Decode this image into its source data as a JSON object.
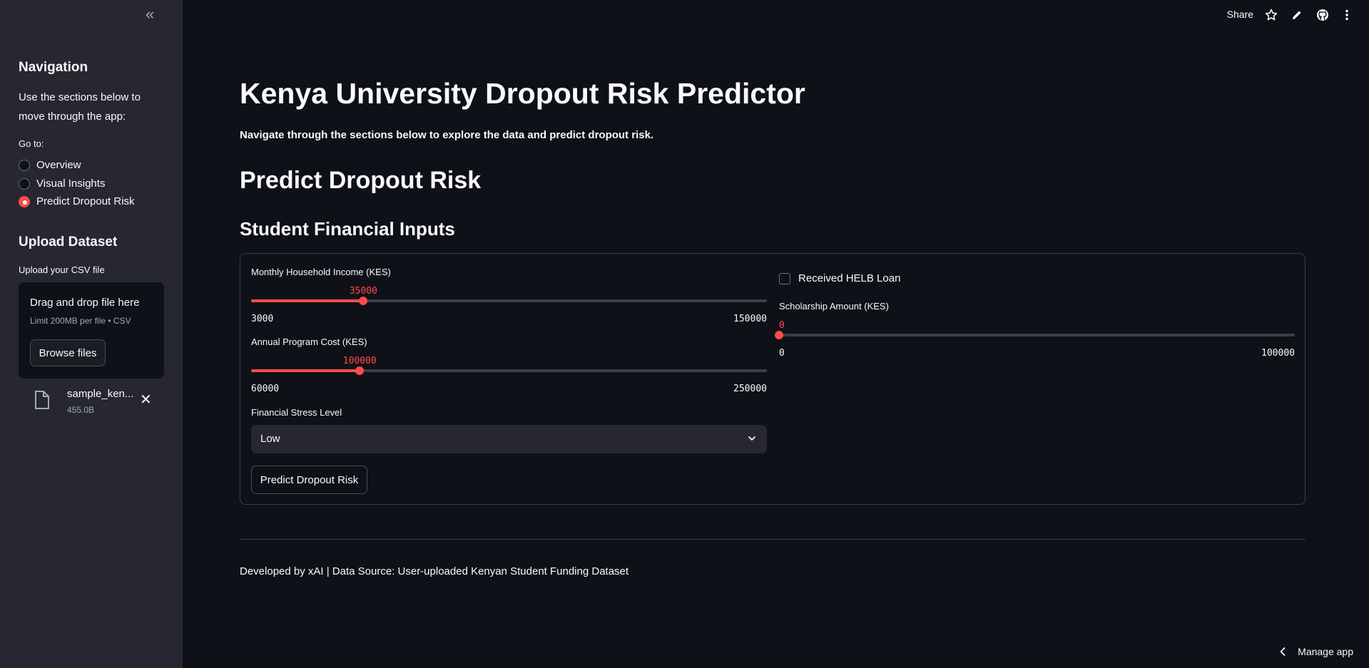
{
  "sidebar": {
    "collapse_glyph": "«",
    "nav_heading": "Navigation",
    "nav_desc": "Use the sections below to move through the app:",
    "goto_label": "Go to:",
    "radio_options": [
      "Overview",
      "Visual Insights",
      "Predict Dropout Risk"
    ],
    "selected_option": "Predict Dropout Risk",
    "upload_heading": "Upload Dataset",
    "upload_label": "Upload your CSV file",
    "dropzone_title": "Drag and drop file here",
    "dropzone_limit": "Limit 200MB per file • CSV",
    "browse_label": "Browse files",
    "file_name": "sample_ken...",
    "file_size": "455.0B"
  },
  "header": {
    "share_label": "Share",
    "icons": [
      "star-icon",
      "edit-icon",
      "github-icon",
      "more-icon"
    ]
  },
  "main": {
    "title": "Kenya University Dropout Risk Predictor",
    "subtitle": "Navigate through the sections below to explore the data and predict dropout risk.",
    "section_title": "Predict Dropout Risk",
    "form_title": "Student Financial Inputs",
    "income_slider": {
      "label": "Monthly Household Income (KES)",
      "value": "35000",
      "min": "3000",
      "max": "150000",
      "fraction": 0.2177
    },
    "cost_slider": {
      "label": "Annual Program Cost (KES)",
      "value": "100000",
      "min": "60000",
      "max": "250000",
      "fraction": 0.2105
    },
    "stress": {
      "label": "Financial Stress Level",
      "value": "Low"
    },
    "predict_label": "Predict Dropout Risk",
    "helb_label": "Received HELB Loan",
    "scholarship_slider": {
      "label": "Scholarship Amount (KES)",
      "value": "0",
      "min": "0",
      "max": "100000",
      "fraction": 0
    }
  },
  "footer": {
    "text": "Developed by xAI | Data Source: User-uploaded Kenyan Student Funding Dataset"
  },
  "manage_app": "Manage app",
  "colors": {
    "accent": "#ff4b4b",
    "background": "#0e1117",
    "sidebar": "#262730"
  }
}
